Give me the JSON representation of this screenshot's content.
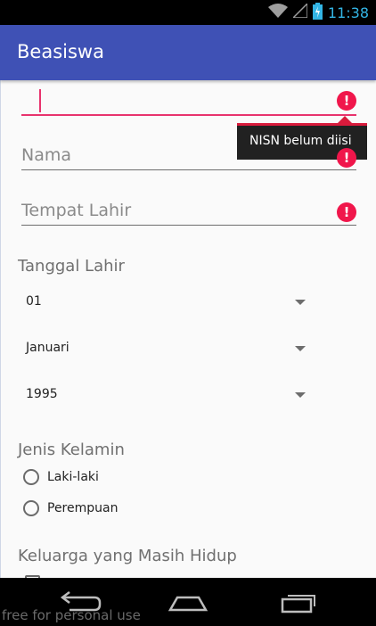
{
  "status_bar": {
    "time": "11:38"
  },
  "app_bar": {
    "title": "Beasiswa"
  },
  "form": {
    "nisn_field": {
      "value": "",
      "error": "NISN belum diisi"
    },
    "nama_field": {
      "placeholder": "Nama"
    },
    "tempat_lahir_field": {
      "placeholder": "Tempat Lahir"
    },
    "tanggal_lahir": {
      "label": "Tanggal Lahir",
      "day": "01",
      "month": "Januari",
      "year": "1995"
    },
    "jenis_kelamin": {
      "label": "Jenis Kelamin",
      "options": [
        "Laki-laki",
        "Perempuan"
      ]
    },
    "keluarga": {
      "label": "Keluarga yang Masih Hidup"
    }
  },
  "watermark": "free for personal use"
}
